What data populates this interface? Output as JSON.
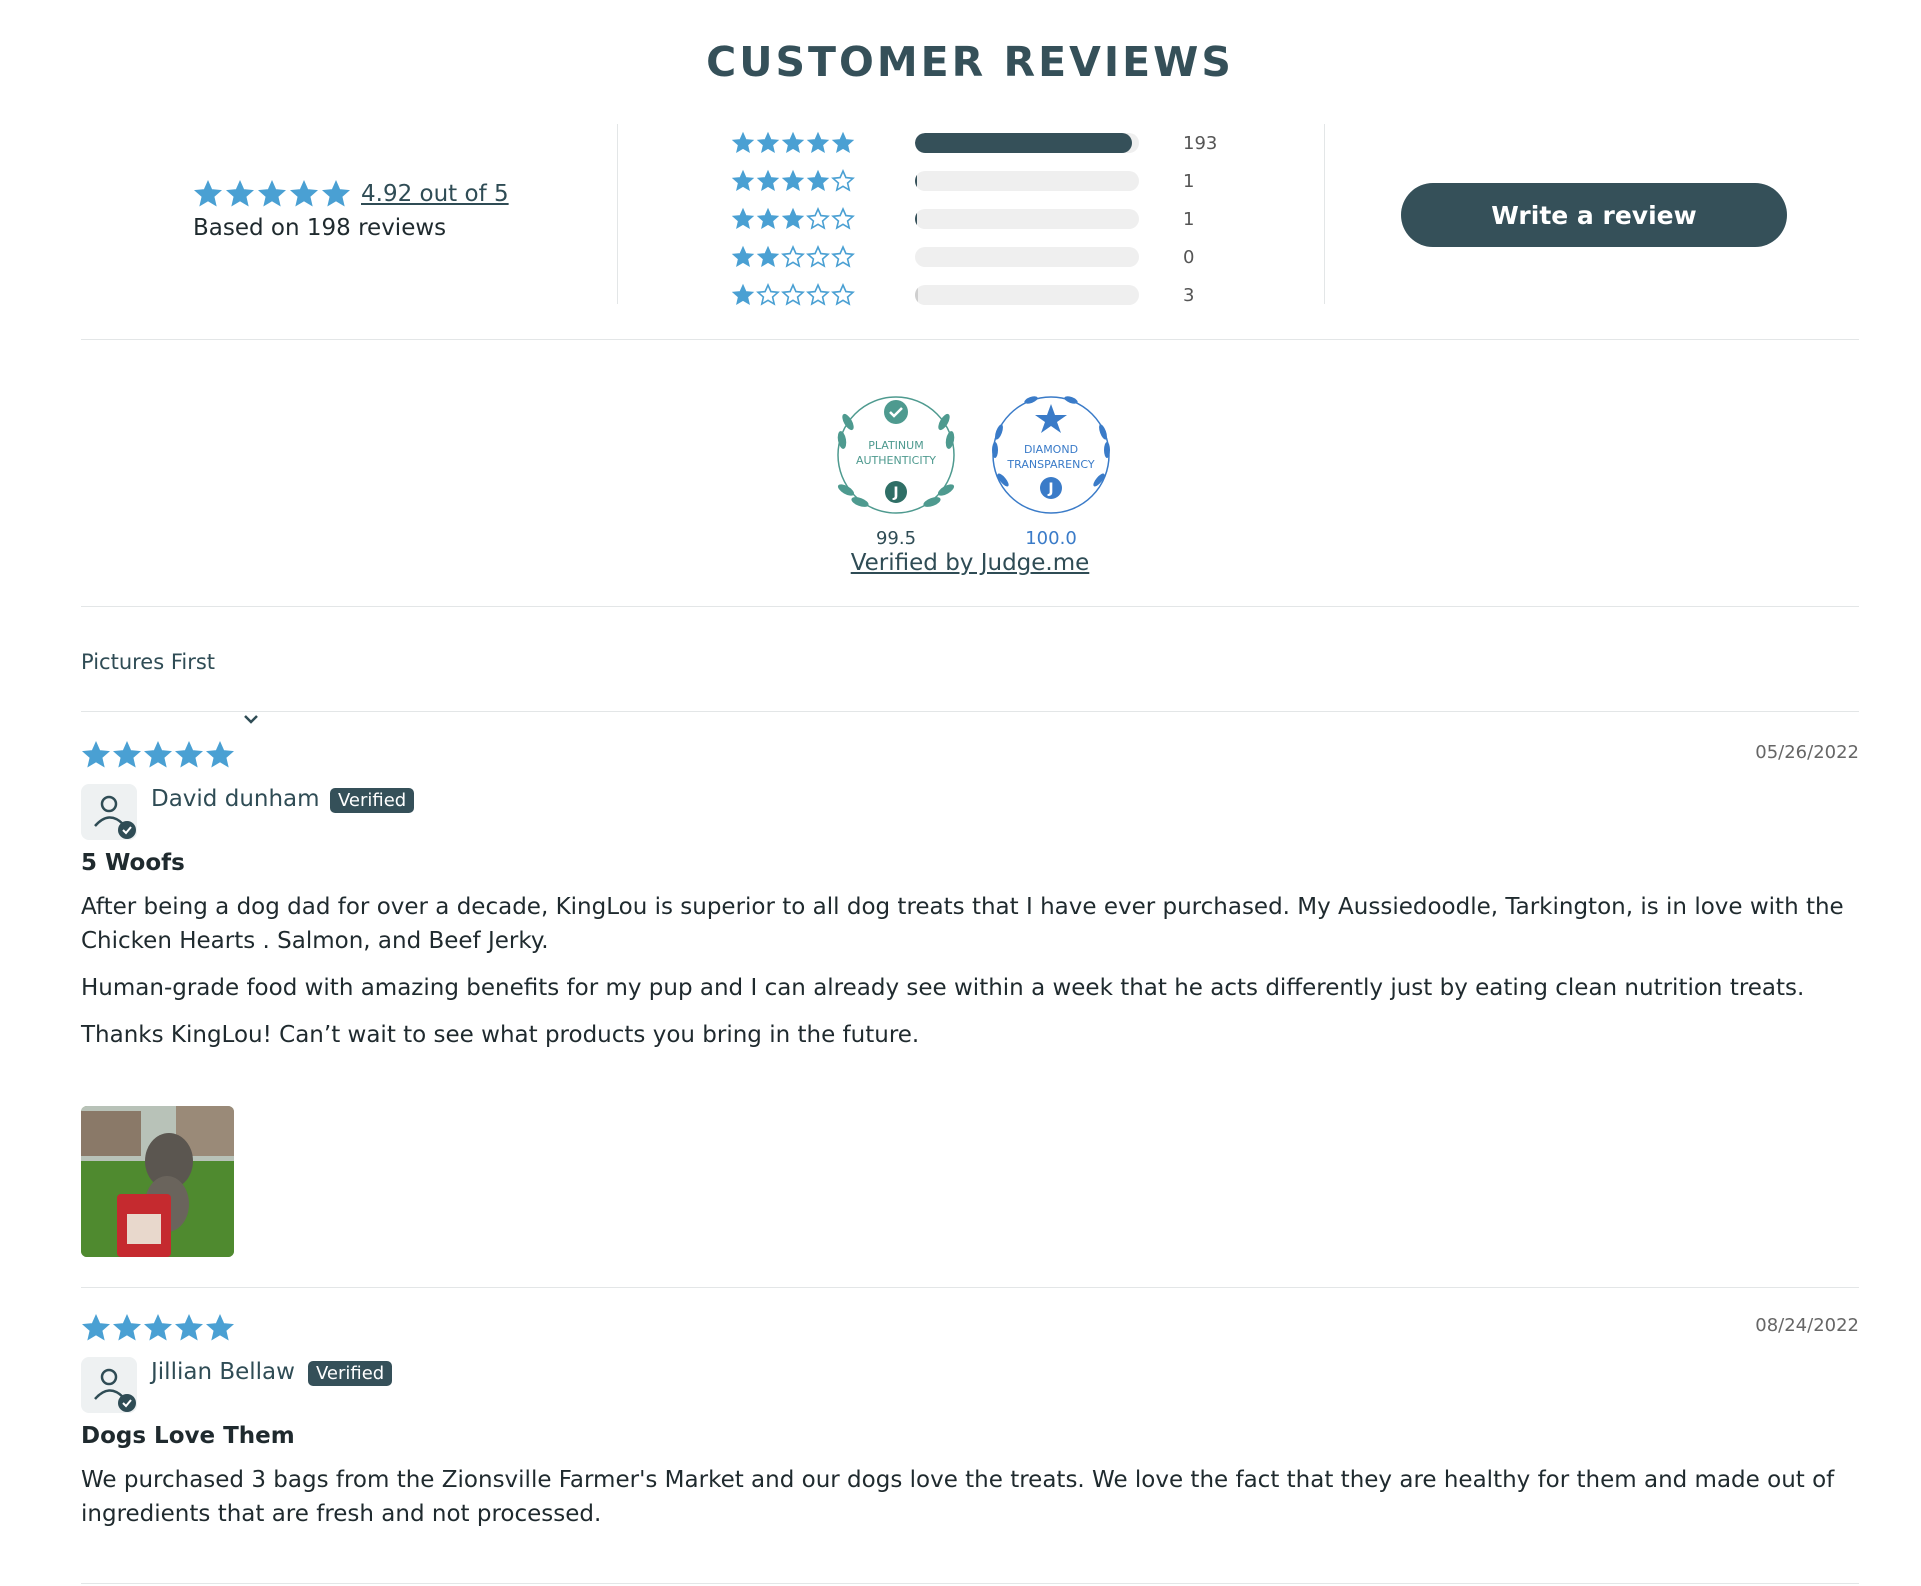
{
  "title": "CUSTOMER REVIEWS",
  "colors": {
    "star": "#4aa0d3",
    "primary": "#355059",
    "bar_bg": "#efefef",
    "badge_green": "#4e9a8f",
    "badge_blue": "#3a7bc8"
  },
  "summary": {
    "average_rating": 4.92,
    "average_label": "4.92 out of 5",
    "based_on": "Based on 198 reviews"
  },
  "histogram": [
    {
      "stars": 5,
      "count_label": "193",
      "count": 193
    },
    {
      "stars": 4,
      "count_label": "1",
      "count": 1
    },
    {
      "stars": 3,
      "count_label": "1",
      "count": 1
    },
    {
      "stars": 2,
      "count_label": "0",
      "count": 0
    },
    {
      "stars": 1,
      "count_label": "3",
      "count": 3
    }
  ],
  "write_review_label": "Write a review",
  "badges": [
    {
      "tier": "PLATINUM",
      "name": "AUTHENTICITY",
      "score": "99.5",
      "icon": "checkmark-icon"
    },
    {
      "tier": "DIAMOND",
      "name": "TRANSPARENCY",
      "score": "100.0",
      "icon": "star-icon"
    }
  ],
  "verified_by": "Verified by Judge.me",
  "sort": {
    "selected": "Pictures First"
  },
  "reviews": [
    {
      "rating": 5,
      "date": "05/26/2022",
      "author": "David dunham",
      "verified_label": "Verified",
      "title": "5 Woofs",
      "paragraphs": [
        "After being a dog dad for over a decade, KingLou is superior to all dog treats that I have ever purchased. My Aussiedoodle, Tarkington, is in love with the Chicken Hearts . Salmon, and Beef Jerky.",
        "Human-grade food with amazing benefits for my pup and I can already see within a week that he acts differently just by eating clean nutrition treats.",
        "Thanks KingLou! Can’t wait to see what products you bring in the future."
      ],
      "has_photo": true
    },
    {
      "rating": 5,
      "date": "08/24/2022",
      "author": "Jillian Bellaw",
      "verified_label": "Verified",
      "title": "Dogs Love Them",
      "paragraphs": [
        "We purchased 3 bags from the Zionsville Farmer's Market and our dogs love the treats. We love the fact that they are healthy for them and made out of ingredients that are fresh and not processed."
      ],
      "has_photo": false
    }
  ]
}
